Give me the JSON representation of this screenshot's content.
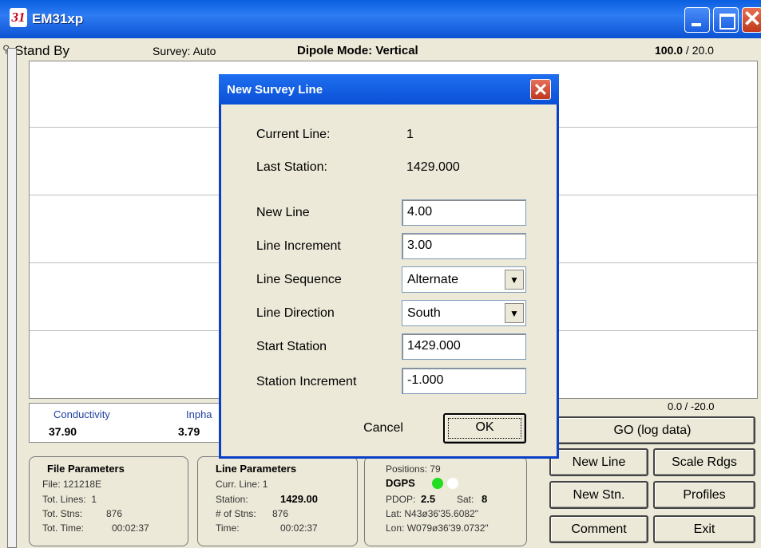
{
  "window": {
    "title": "EM31xp",
    "logo_text": "31"
  },
  "status": {
    "state": "Stand By",
    "survey": "Survey: Auto",
    "dipole": "Dipole Mode: Vertical",
    "scale_top_bold": "100.0",
    "scale_top_rest": " / 20.0",
    "scale_bottom": "0.0 / -20.0"
  },
  "readings": {
    "conductivity_label": "Conductivity",
    "conductivity_value": "37.90",
    "inphase_label": "Inpha",
    "inphase_value": "3.79"
  },
  "file_params": {
    "title": "File Parameters",
    "file": "File: 121218E",
    "lines": "Tot. Lines:  1",
    "stns_label": "Tot. Stns:",
    "stns": "876",
    "time_label": "Tot. Time:",
    "time": "00:02:37"
  },
  "line_params": {
    "title": "Line Parameters",
    "curr": "Curr. Line: 1",
    "station_label": "Station:",
    "station": "1429.00",
    "nstns_label": "# of Stns:",
    "nstns": "876",
    "time_label": "Time:",
    "time": "00:02:37"
  },
  "gps": {
    "positions": "Positions: 79",
    "mode": "DGPS",
    "pdop_label": "PDOP:",
    "pdop": "2.5",
    "sat_label": "Sat:",
    "sat": "8",
    "lat": "Lat: N43ø36'35.6082\"",
    "lon": "Lon: W079ø36'39.0732\"",
    "dot_colors": [
      "#22dd22",
      "#ffffff"
    ]
  },
  "buttons": {
    "go": "GO (log data)",
    "new_line": "New Line",
    "scale": "Scale Rdgs",
    "new_stn": "New Stn.",
    "profiles": "Profiles",
    "comment": "Comment",
    "exit": "Exit"
  },
  "dialog": {
    "title": "New Survey Line",
    "current_line_label": "Current Line:",
    "current_line": "1",
    "last_station_label": "Last Station:",
    "last_station": "1429.000",
    "new_line_label": "New Line",
    "new_line": "4.00",
    "line_increment_label": "Line Increment",
    "line_increment": "3.00",
    "line_sequence_label": "Line Sequence",
    "line_sequence": "Alternate",
    "line_direction_label": "Line Direction",
    "line_direction": "South",
    "start_station_label": "Start Station",
    "start_station": "1429.000",
    "station_increment_label": "Station Increment",
    "station_increment": "-1.000",
    "cancel": "Cancel",
    "ok": "OK"
  }
}
